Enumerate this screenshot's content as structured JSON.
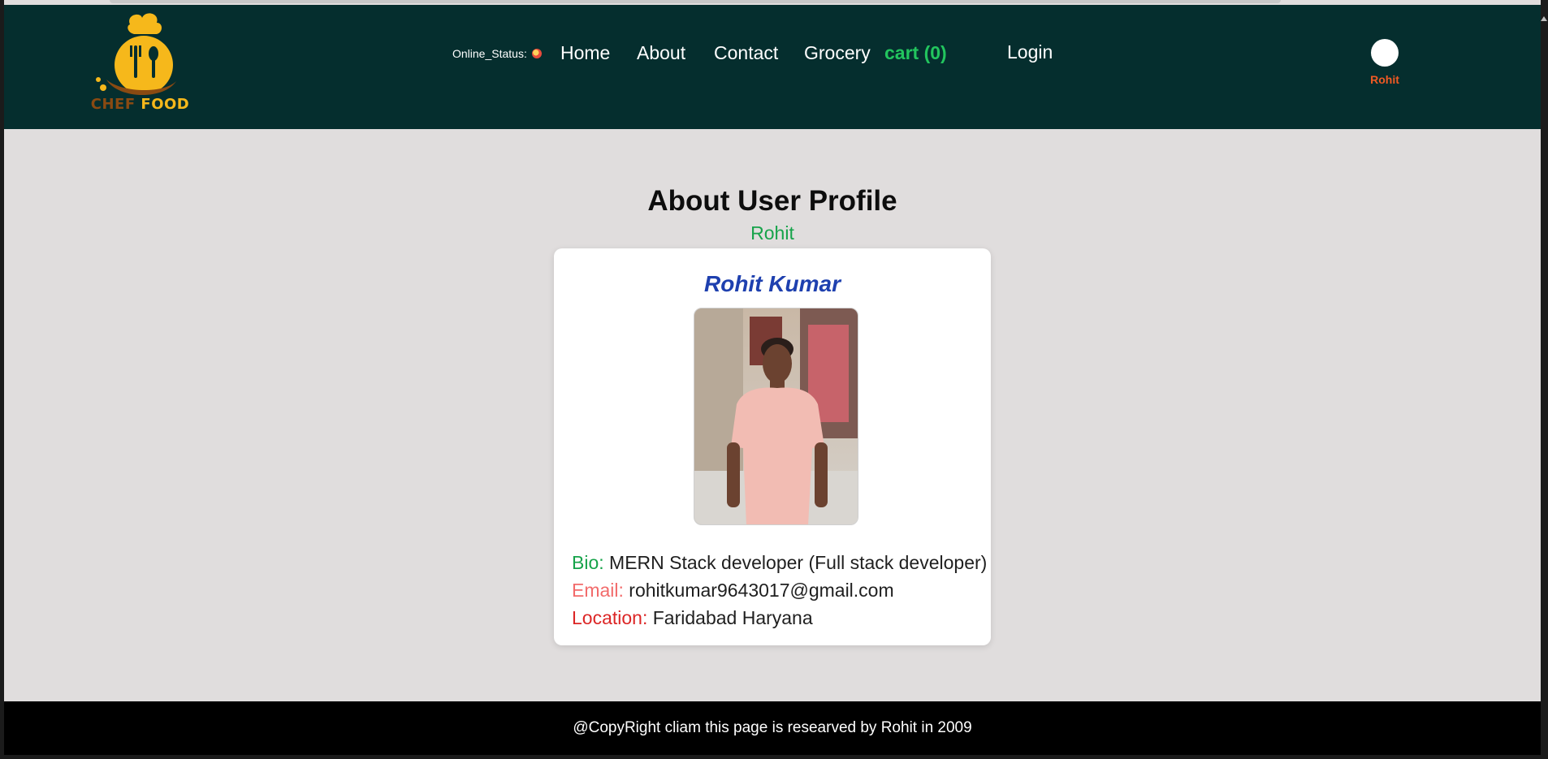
{
  "header": {
    "logo": {
      "word1": "CHEF",
      "word2": "FOOD"
    },
    "status_label": "Online_Status:",
    "nav": [
      {
        "label": "Home"
      },
      {
        "label": "About"
      },
      {
        "label": "Contact"
      },
      {
        "label": "Grocery"
      }
    ],
    "cart_label": "cart (0)",
    "login_label": "Login",
    "user_name": "Rohit"
  },
  "main": {
    "title": "About User Profile",
    "subtitle": "Rohit",
    "card": {
      "name": "Rohit Kumar",
      "bio_key": "Bio:",
      "bio_value": "MERN Stack developer (Full stack developer)",
      "email_key": "Email:",
      "email_value": "rohitkumar9643017@gmail.com",
      "location_key": "Location:",
      "location_value": "Faridabad Haryana"
    }
  },
  "footer": {
    "text": "@CopyRight cliam this page is researved by Rohit in 2009"
  },
  "colors": {
    "header_bg": "#052e2e",
    "page_bg": "#e0dddd",
    "accent_green": "#16a34a",
    "name_blue": "#1e40af",
    "footer_bg": "#000000"
  }
}
